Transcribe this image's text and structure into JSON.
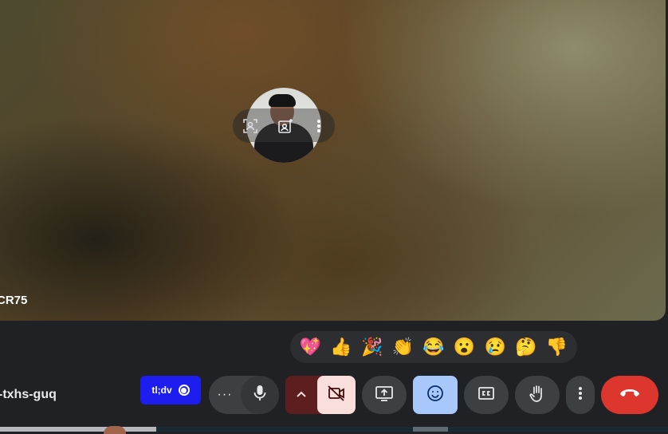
{
  "participant": {
    "name": "CR75"
  },
  "tile_controls": {
    "frame_icon": "frame-person-icon",
    "effects_icon": "visual-effects-icon",
    "more_icon": "more-vert-icon"
  },
  "reactions": [
    {
      "emoji": "💖",
      "name": "sparkling-heart"
    },
    {
      "emoji": "👍",
      "name": "thumbs-up"
    },
    {
      "emoji": "🎉",
      "name": "party-popper"
    },
    {
      "emoji": "👏",
      "name": "clapping-hands"
    },
    {
      "emoji": "😂",
      "name": "tears-of-joy"
    },
    {
      "emoji": "😮",
      "name": "surprised"
    },
    {
      "emoji": "😢",
      "name": "crying"
    },
    {
      "emoji": "🤔",
      "name": "thinking"
    },
    {
      "emoji": "👎",
      "name": "thumbs-down"
    }
  ],
  "meeting": {
    "code": "-txhs-guq"
  },
  "toolbar": {
    "tldv_label": "tl;dv",
    "mic_more_label": "···"
  },
  "colors": {
    "end_call": "#dc362e",
    "emoji_active": "#a8c7fa",
    "camera_off_bg": "#f9dedc",
    "tldv": "#1d1df0"
  }
}
